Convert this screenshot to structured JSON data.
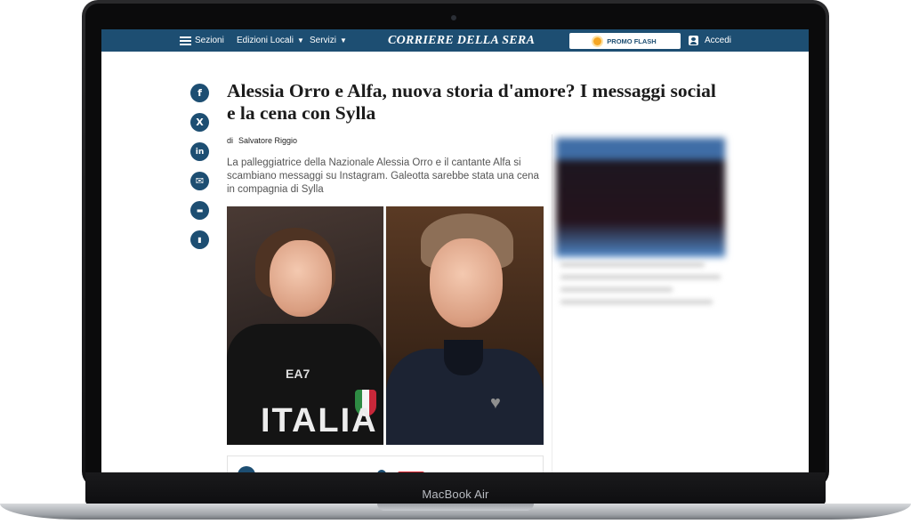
{
  "device": {
    "label": "MacBook Air"
  },
  "topbar": {
    "sezioni": "Sezioni",
    "edizioni": "Edizioni Locali",
    "servizi": "Servizi",
    "logo": "CORRIERE DELLA SERA",
    "promo": "PROMO FLASH",
    "accedi": "Accedi"
  },
  "share": {
    "facebook": "f",
    "x": "X",
    "linkedin": "in",
    "email": "✉",
    "comment": "▬",
    "bookmark": "▮"
  },
  "article": {
    "title": "Alessia Orro e Alfa, nuova storia d'amore? I messaggi social e la cena con Sylla",
    "byline_prefix": "di",
    "author": "Salvatore Riggio",
    "summary": "La palleggiatrice della Nazionale Alessia Orro e il cantante Alfa si scambiano messaggi su Instagram. Galeotta sarebbe stata una cena in compagnia di Sylla",
    "photo_text": "ITALIA",
    "photo_logo": "EA7"
  },
  "colors": {
    "brand": "#1d4e72",
    "accent_red": "#d9232e",
    "promo_sun": "#f5a623"
  },
  "icons": [
    "menu-icon",
    "chevron-down-icon",
    "sun-icon",
    "user-icon",
    "facebook-icon",
    "x-icon",
    "linkedin-icon",
    "email-icon",
    "comment-icon",
    "bookmark-icon"
  ]
}
